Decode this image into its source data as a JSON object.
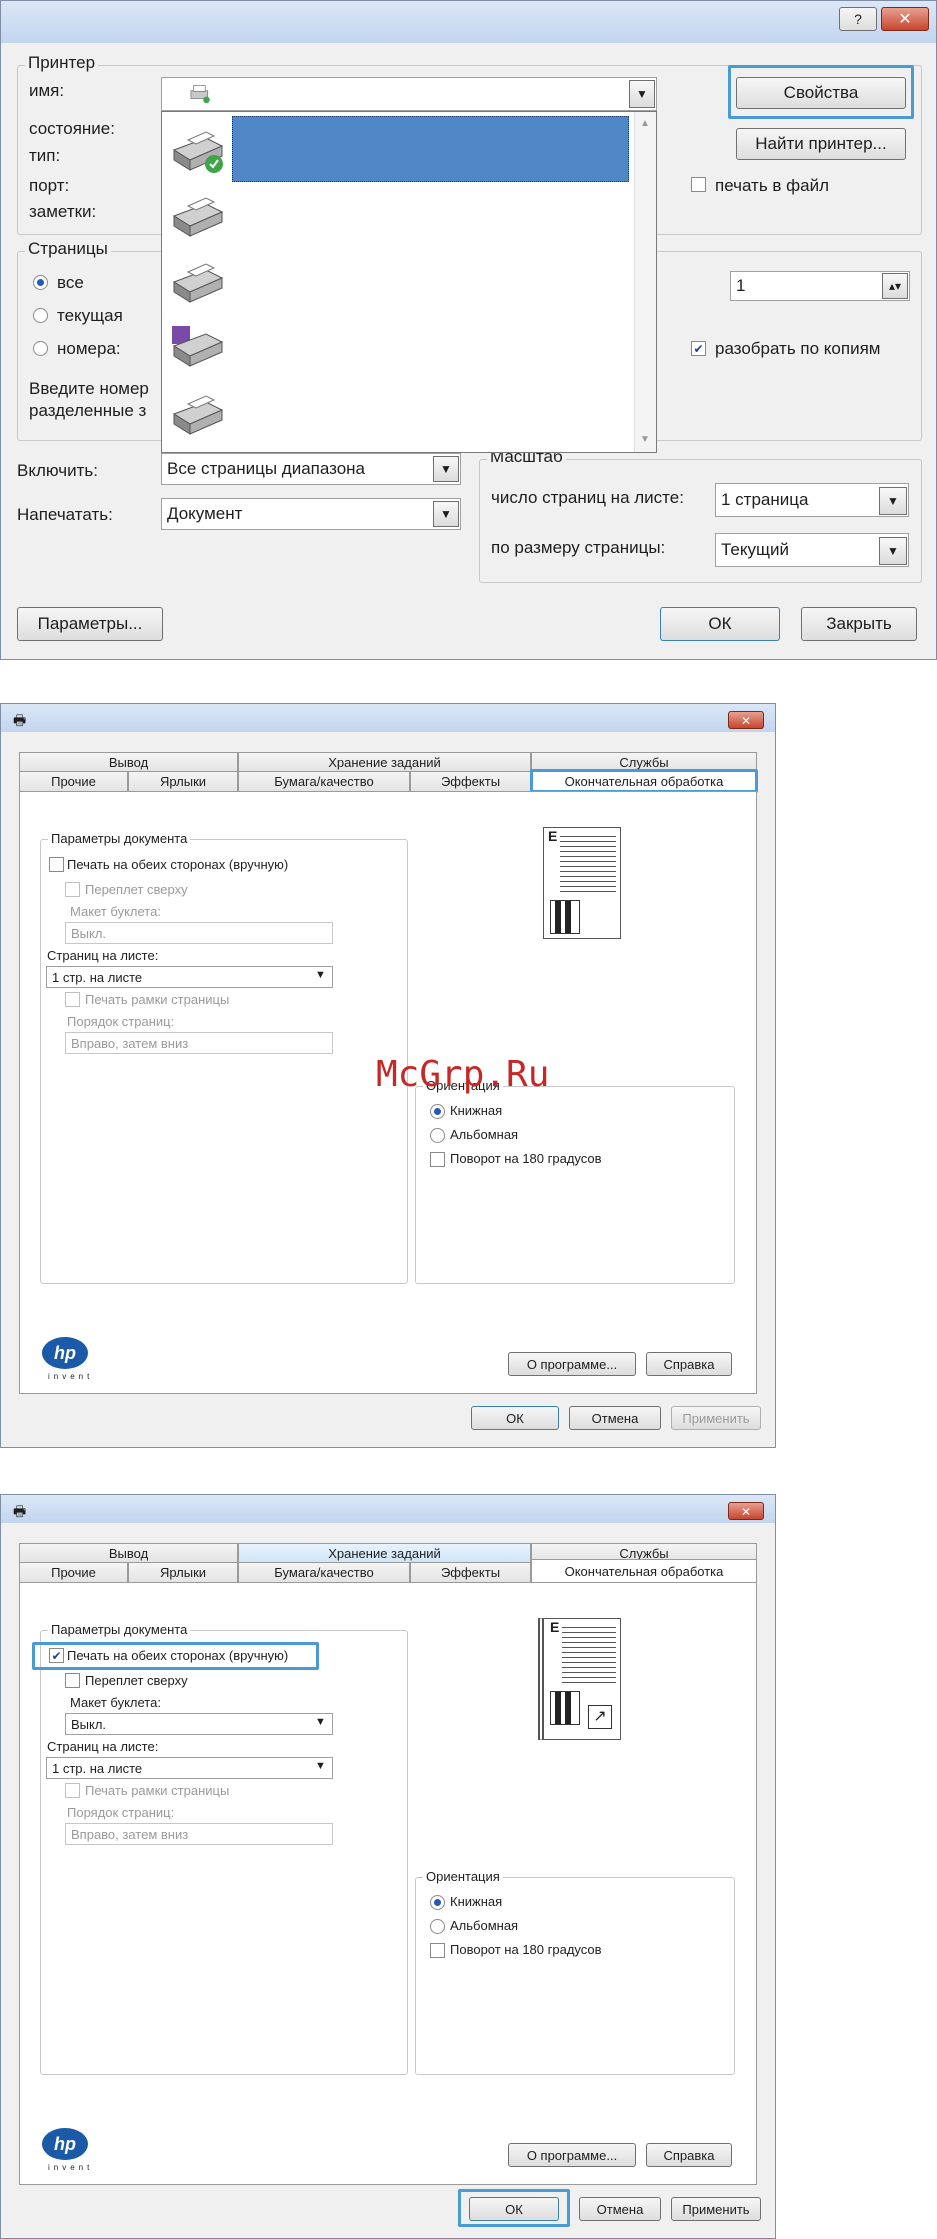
{
  "print_dialog": {
    "buttons": {
      "help": "?",
      "close": "✕",
      "properties": "Свойства",
      "find_printer": "Найти принтер...",
      "params": "Параметры...",
      "ok": "ОК",
      "close_dialog": "Закрыть"
    },
    "printer": {
      "group_title": "Принтер",
      "name_label": "имя:",
      "status_label": "состояние:",
      "type_label": "тип:",
      "port_label": "порт:",
      "notes_label": "заметки:",
      "print_to_file": "печать в файл"
    },
    "pages": {
      "group_title": "Страницы",
      "all": "все",
      "current": "текущая",
      "numbers": "номера:",
      "hint_line1": "Введите номер",
      "hint_line2": "разделенные з"
    },
    "copies": {
      "value": "1",
      "collate": "разобрать по копиям"
    },
    "include": {
      "label": "Включить:",
      "value": "Все страницы диапазона"
    },
    "print_what": {
      "label": "Напечатать:",
      "value": "Документ"
    },
    "scale": {
      "group_title": "Масштаб",
      "pages_per_sheet_label": "число страниц на листе:",
      "pages_per_sheet_value": "1 страница",
      "fit_label": "по размеру страницы:",
      "fit_value": "Текущий"
    }
  },
  "driver_tabs": {
    "row1": [
      "Вывод",
      "Хранение заданий",
      "Службы"
    ],
    "row2": [
      "Прочие",
      "Ярлыки",
      "Бумага/качество",
      "Эффекты",
      "Окончательная обработка"
    ]
  },
  "driver": {
    "doc_params": "Параметры документа",
    "duplex": "Печать на обеих сторонах (вручную)",
    "flip_up": "Переплет сверху",
    "booklet_label": "Макет буклета:",
    "booklet_value": "Выкл.",
    "pages_per_sheet_label": "Страниц на листе:",
    "pages_per_sheet_value": "1 стр. на листе",
    "page_borders": "Печать рамки страницы",
    "page_order_label": "Порядок страниц:",
    "page_order_value": "Вправо, затем вниз",
    "orientation": "Ориентация",
    "portrait": "Книжная",
    "landscape": "Альбомная",
    "rotate": "Поворот на 180 градусов",
    "about": "О программе...",
    "help": "Справка",
    "ok": "ОК",
    "cancel": "Отмена",
    "apply": "Применить",
    "preview_letter": "E",
    "hp_logo": "hp",
    "invent": "invent"
  },
  "watermark": "McGrp.Ru"
}
